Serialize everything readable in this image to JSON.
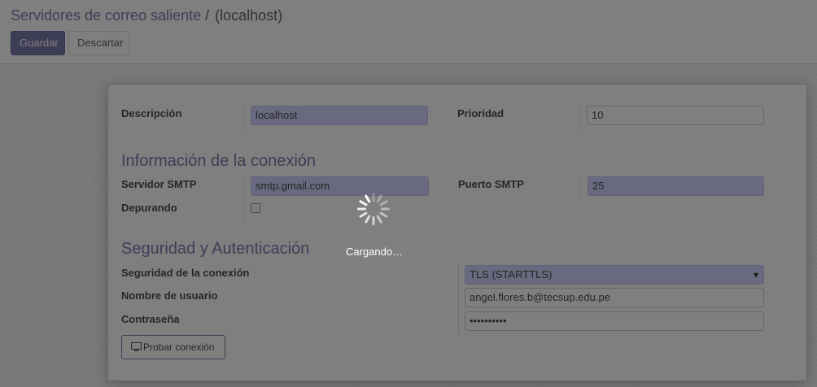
{
  "header": {
    "breadcrumb_parent": "Servidores de correo saliente",
    "breadcrumb_sep": "/",
    "breadcrumb_current": "(localhost)",
    "save_label": "Guardar",
    "discard_label": "Descartar"
  },
  "form": {
    "description": {
      "label": "Descripción",
      "value": "localhost"
    },
    "priority": {
      "label": "Prioridad",
      "value": "10"
    },
    "connection_section": "Información de la conexión",
    "smtp_server": {
      "label": "Servidor SMTP",
      "value": "smtp.gmail.com"
    },
    "smtp_port": {
      "label": "Puerto SMTP",
      "value": "25"
    },
    "debugging": {
      "label": "Depurando",
      "checked": false
    },
    "security_section": "Seguridad y Autenticación",
    "connection_security": {
      "label": "Seguridad de la conexión",
      "value": "TLS (STARTTLS)"
    },
    "username": {
      "label": "Nombre de usuario",
      "value": "angel.flores.b@tecsup.edu.pe"
    },
    "password": {
      "label": "Contraseña",
      "value": "••••••••••"
    },
    "test_button": "Probar conexión"
  },
  "loading": {
    "text": "Cargando…"
  },
  "colors": {
    "accent": "#7c7bad",
    "required_field": "#d2d2ff",
    "overlay": "rgba(0,0,0,0.5)"
  }
}
